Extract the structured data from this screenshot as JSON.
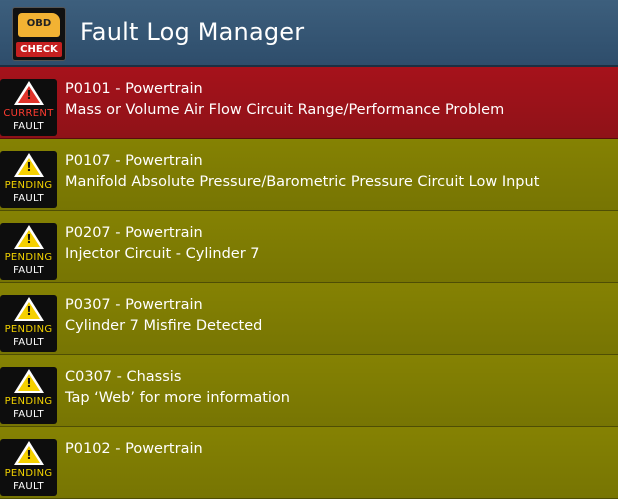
{
  "app": {
    "title": "Fault Log Manager",
    "icon": {
      "name": "obd-check-engine-icon",
      "top_text": "OBD",
      "bottom_text": "CHECK"
    }
  },
  "faults": [
    {
      "status": "current",
      "badge_top": "CURRENT",
      "badge_bottom": "FAULT",
      "code_line": "P0101 - Powertrain",
      "description": "Mass or Volume Air Flow Circuit Range/Performance Problem"
    },
    {
      "status": "pending",
      "badge_top": "PENDING",
      "badge_bottom": "FAULT",
      "code_line": "P0107 - Powertrain",
      "description": "Manifold Absolute Pressure/Barometric Pressure Circuit Low Input"
    },
    {
      "status": "pending",
      "badge_top": "PENDING",
      "badge_bottom": "FAULT",
      "code_line": "P0207 - Powertrain",
      "description": "Injector Circuit - Cylinder 7"
    },
    {
      "status": "pending",
      "badge_top": "PENDING",
      "badge_bottom": "FAULT",
      "code_line": "P0307 - Powertrain",
      "description": "Cylinder 7 Misfire Detected"
    },
    {
      "status": "pending",
      "badge_top": "PENDING",
      "badge_bottom": "FAULT",
      "code_line": "C0307 - Chassis",
      "description": "Tap ‘Web’ for more information"
    },
    {
      "status": "pending",
      "badge_top": "PENDING",
      "badge_bottom": "FAULT",
      "code_line": "P0102 - Powertrain",
      "description": ""
    }
  ],
  "colors": {
    "action_bar": "#2e4d6b",
    "current_fault_bg": "#a6121b",
    "pending_fault_bg": "#7c7a03",
    "warning_yellow": "#f5d000"
  }
}
